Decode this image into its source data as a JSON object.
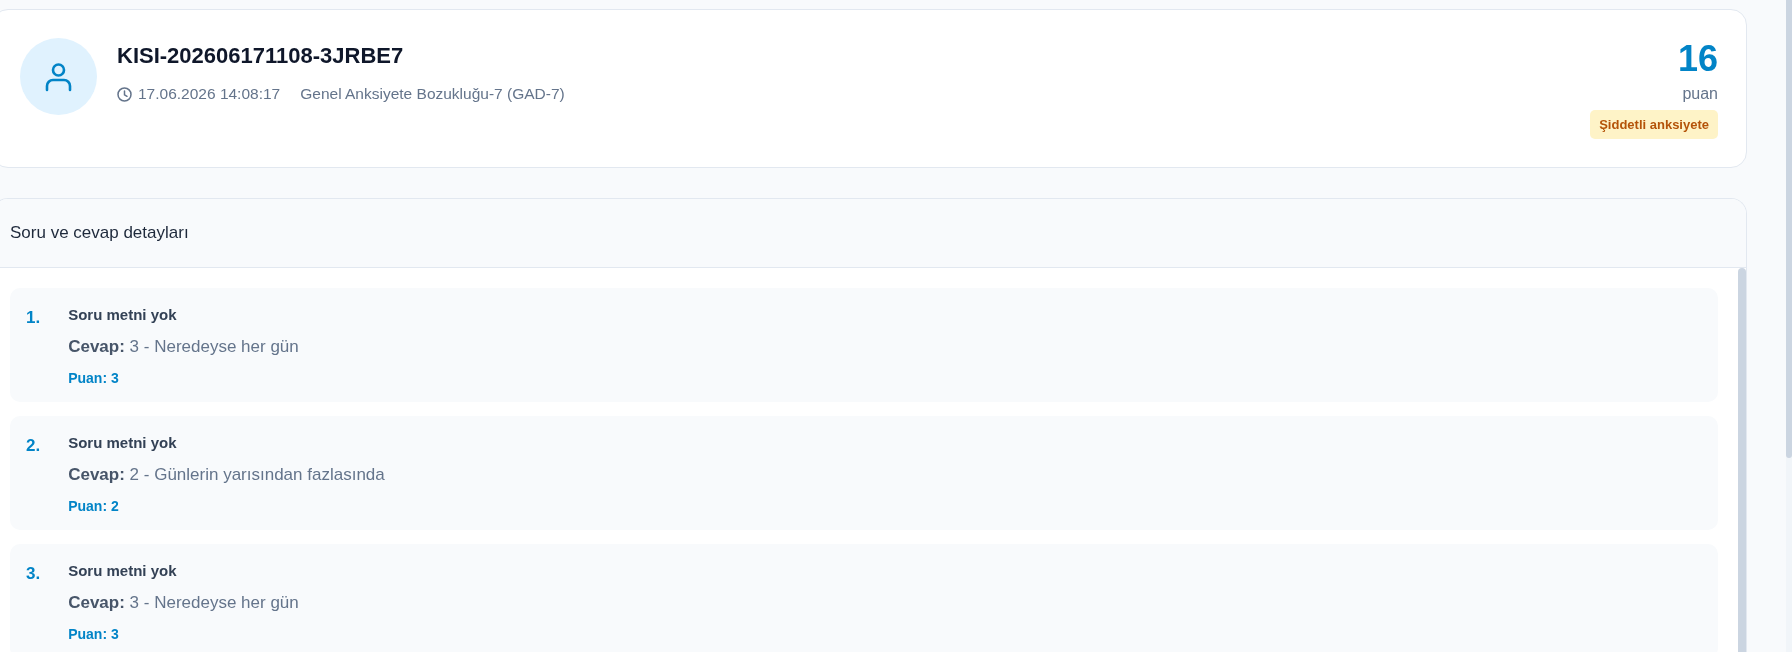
{
  "record": {
    "id": "KISI-202606171108-3JRBE7",
    "datetime": "17.06.2026 14:08:17",
    "scale": "Genel Anksiyete Bozukluğu-7 (GAD-7)",
    "score": "16",
    "score_unit": "puan",
    "severity": "Şiddetli anksiyete"
  },
  "details": {
    "title": "Soru ve cevap detayları",
    "items": [
      {
        "number": "1.",
        "question": "Soru metni yok",
        "answer": "**Cevap:** 3 - Neredeyse her gün",
        "points": "Puan: 3"
      },
      {
        "number": "2.",
        "question": "Soru metni yok",
        "answer": "**Cevap:** 2 - Günlerin yarısından fazlasında",
        "points": "Puan: 2"
      },
      {
        "number": "3.",
        "question": "Soru metni yok",
        "answer": "**Cevap:** 3 - Neredeyse her gün",
        "points": "Puan: 3"
      }
    ]
  }
}
